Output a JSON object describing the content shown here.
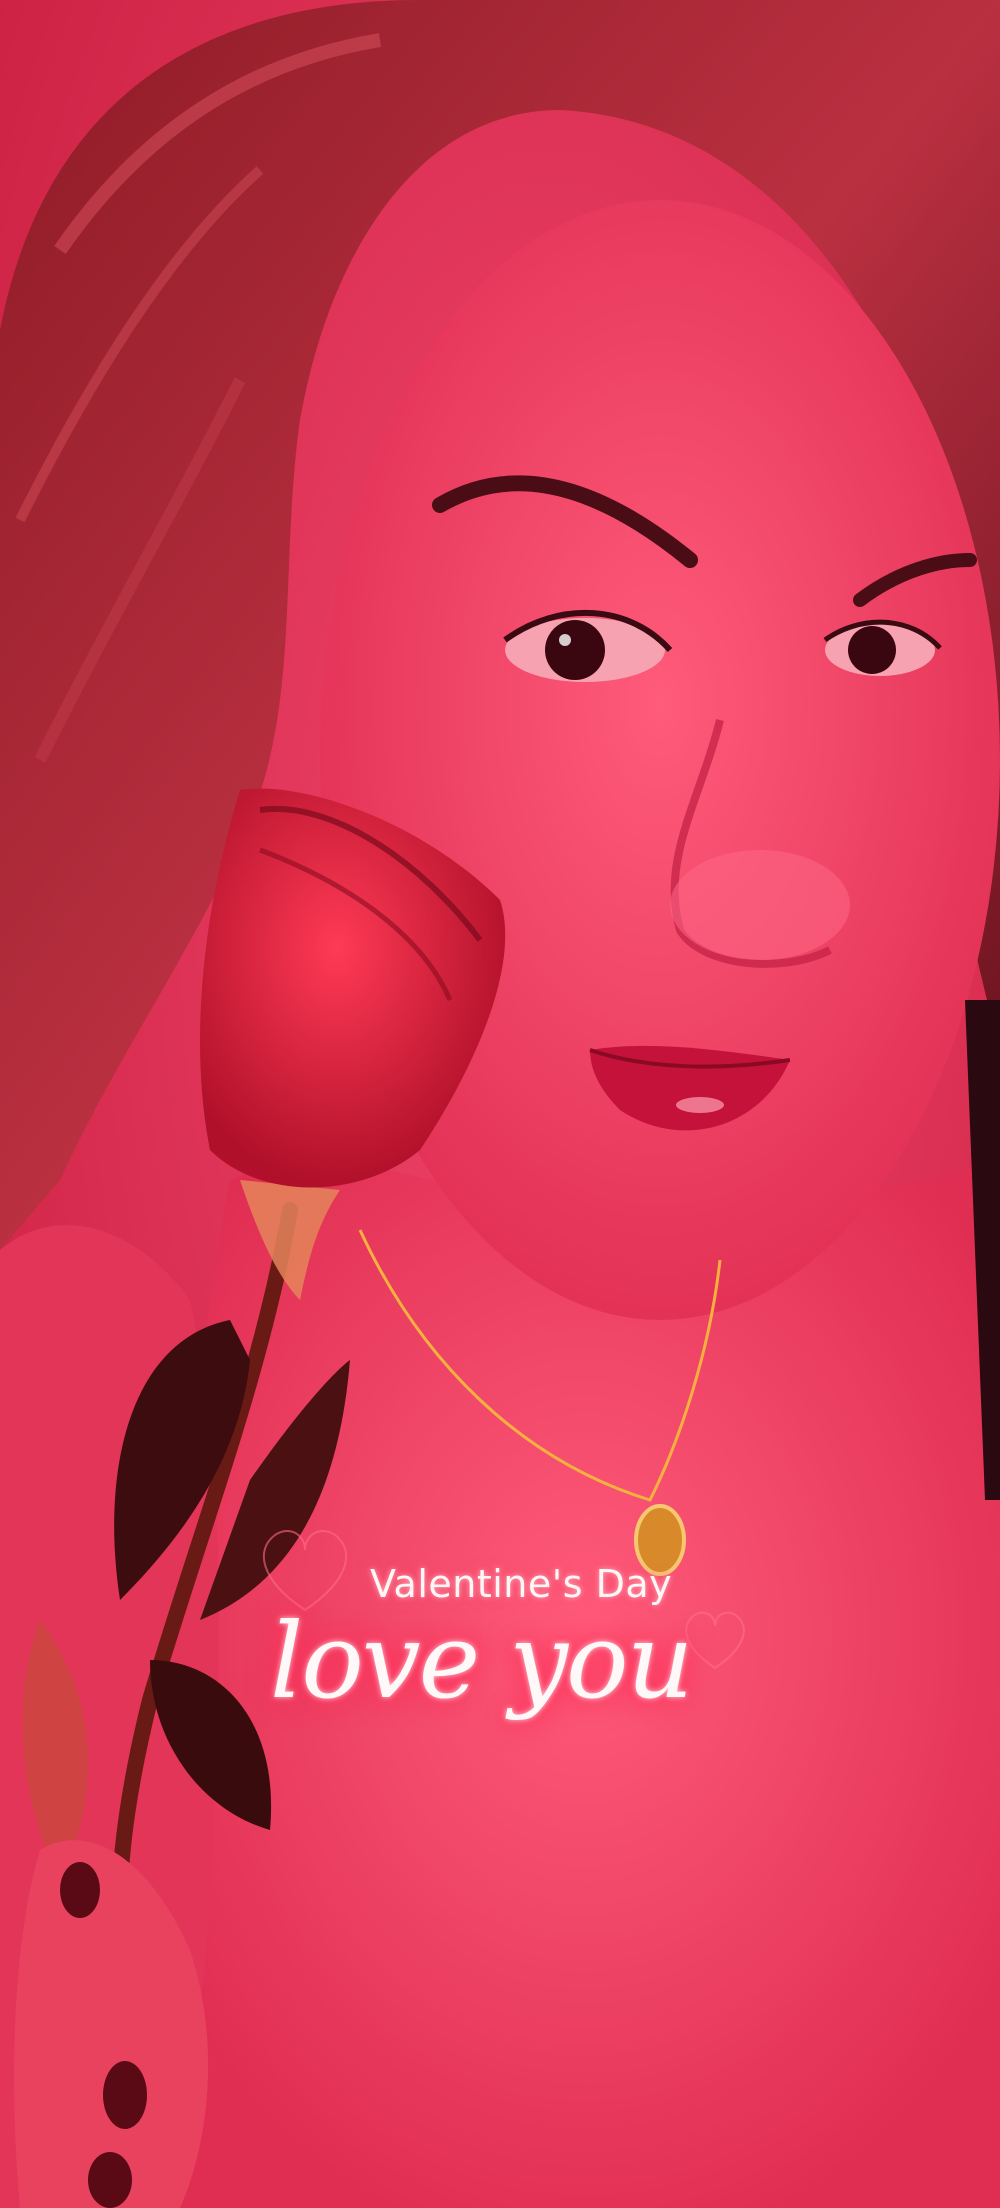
{
  "photo": {
    "description_icons": [
      "rose-icon",
      "heart-icon"
    ]
  },
  "sticker": {
    "small_text": "Valentine's Day",
    "script_text": "love you"
  },
  "colors": {
    "tint": "#d8244a",
    "glow": "#ff3d63"
  }
}
